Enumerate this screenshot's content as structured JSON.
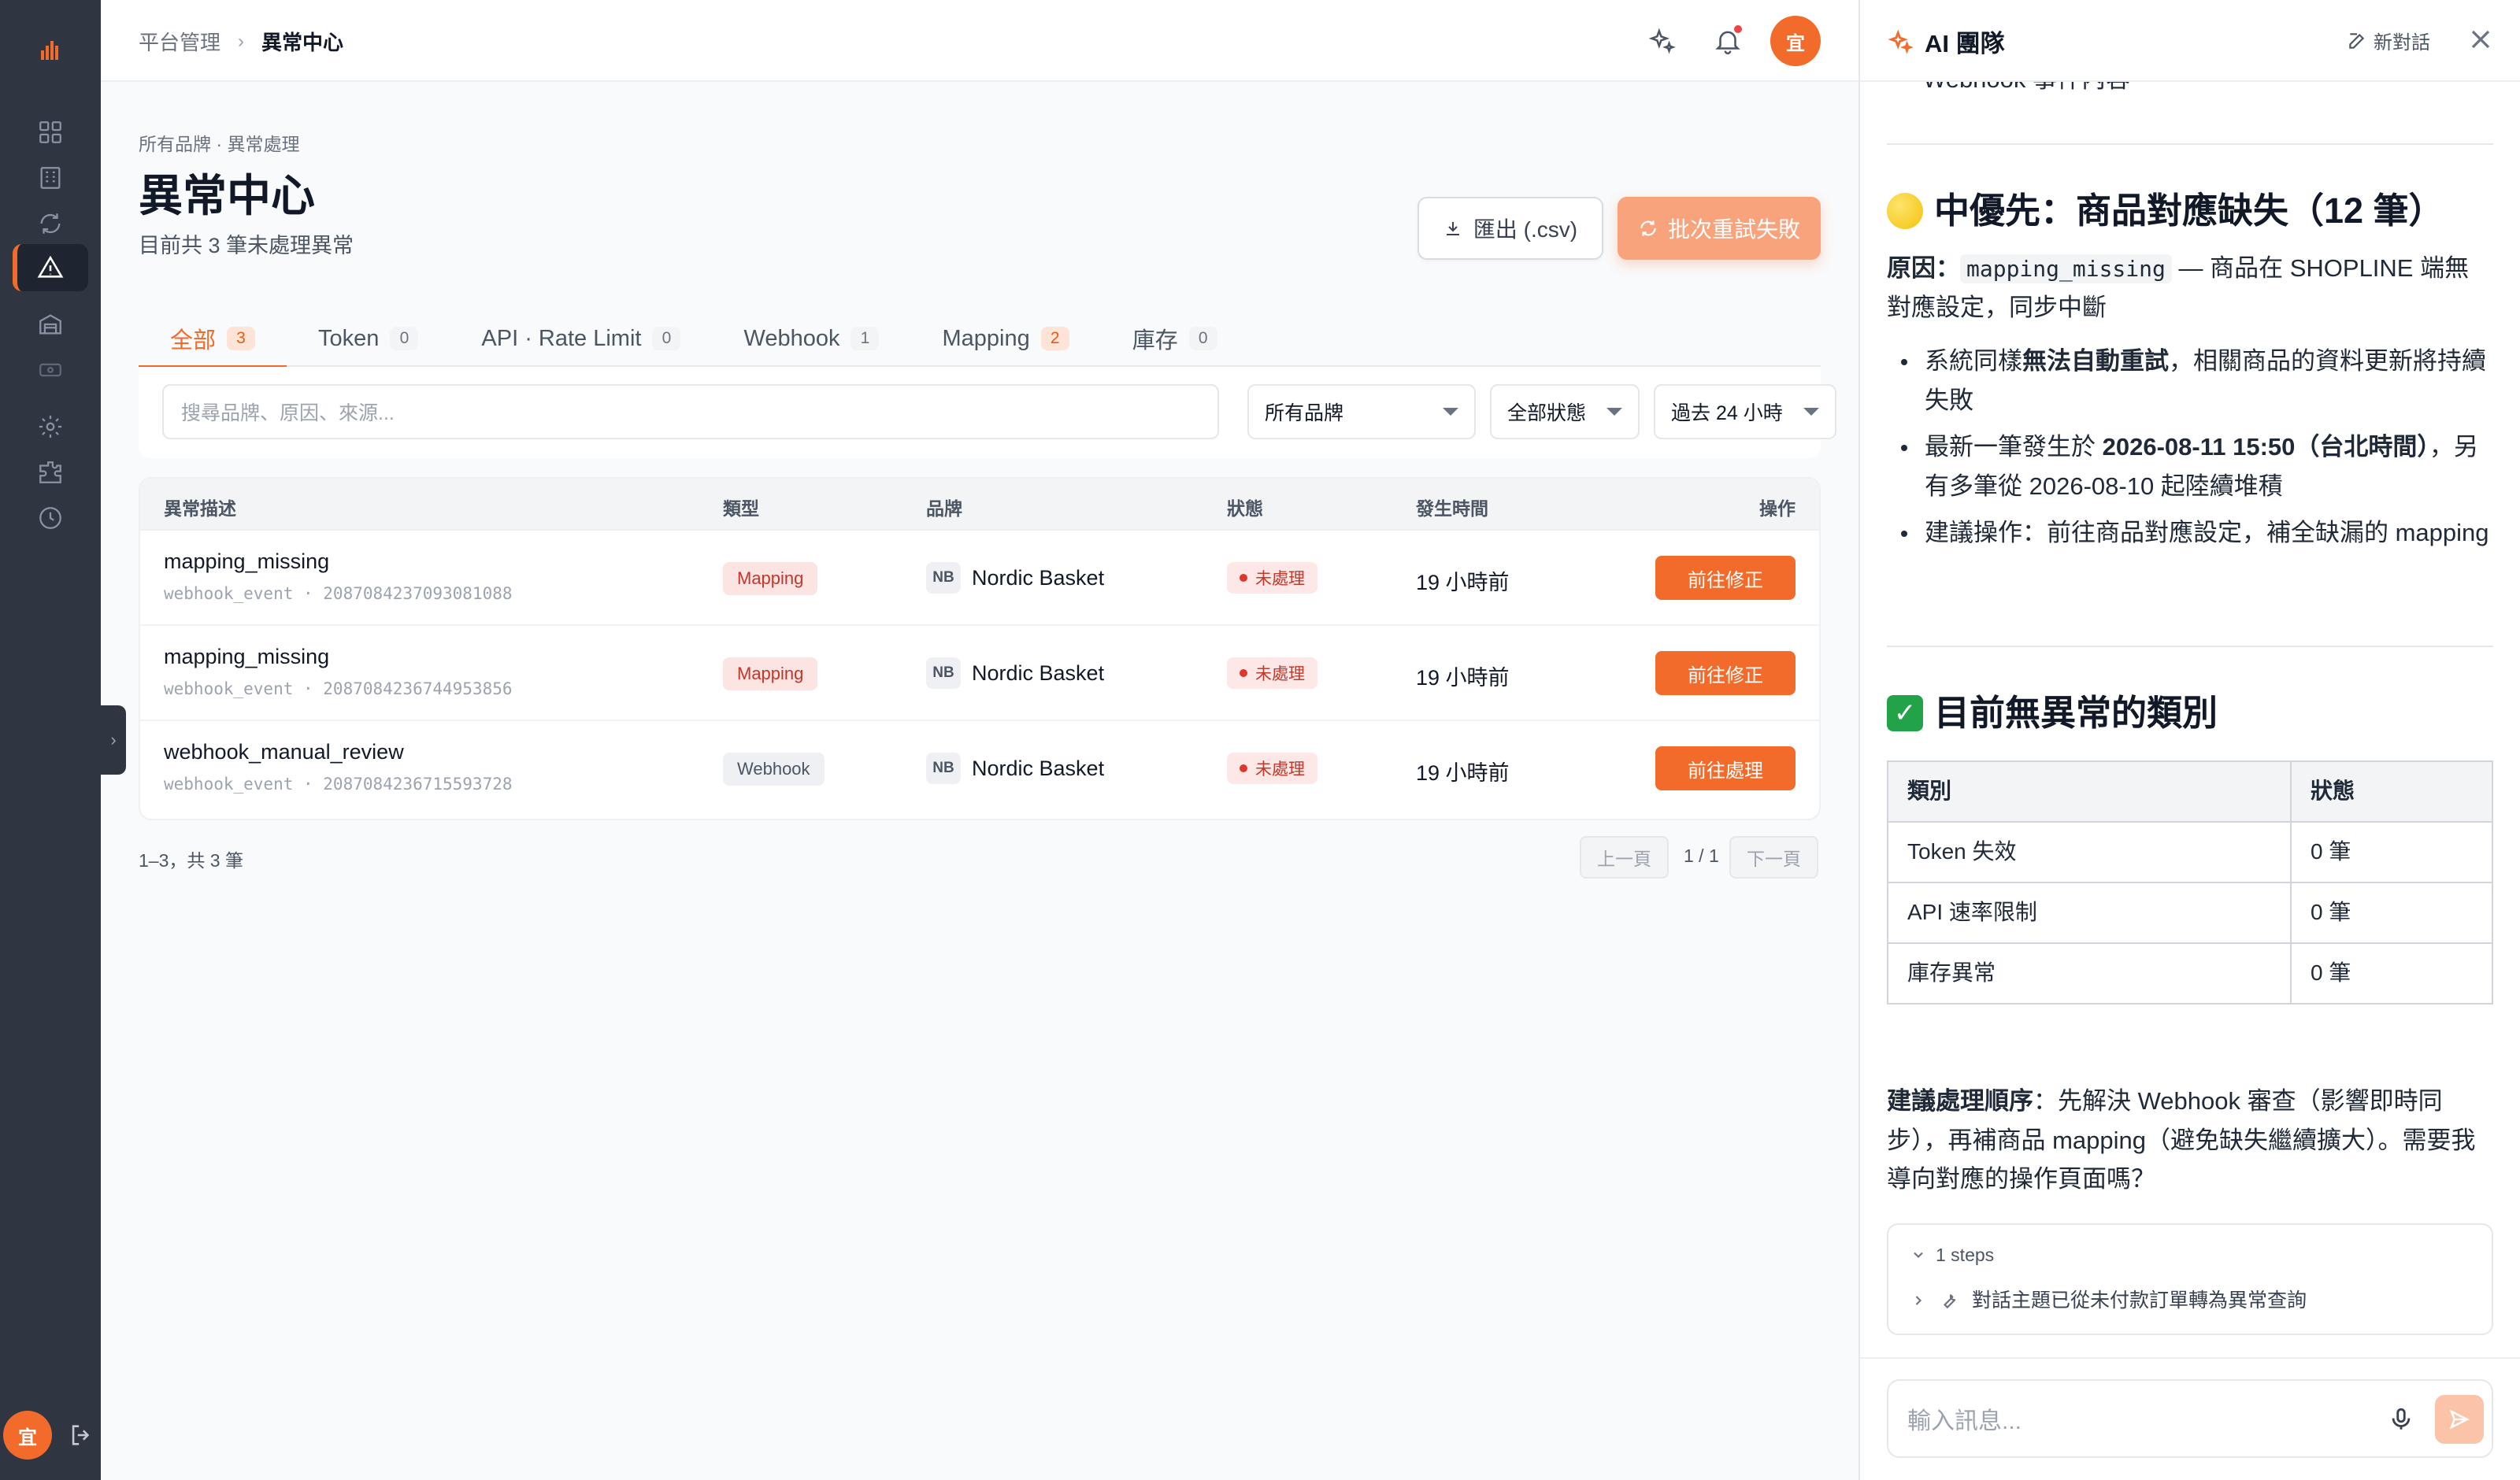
{
  "topbar": {
    "breadcrumb_root": "平台管理",
    "breadcrumb_current": "異常中心",
    "avatar_text": "宜"
  },
  "header": {
    "sub_breadcrumb": "所有品牌 · 異常處理",
    "title": "異常中心",
    "subtitle": "目前共 3 筆未處理異常",
    "export_label": "匯出 (.csv)",
    "retry_label": "批次重試失敗"
  },
  "tabs": [
    {
      "label": "全部",
      "count": "3"
    },
    {
      "label": "Token",
      "count": "0"
    },
    {
      "label": "API · Rate Limit",
      "count": "0"
    },
    {
      "label": "Webhook",
      "count": "1"
    },
    {
      "label": "Mapping",
      "count": "2"
    },
    {
      "label": "庫存",
      "count": "0"
    }
  ],
  "filters": {
    "search_placeholder": "搜尋品牌、原因、來源...",
    "brand": "所有品牌",
    "status": "全部狀態",
    "range": "過去 24 小時"
  },
  "table": {
    "columns": [
      "異常描述",
      "類型",
      "品牌",
      "狀態",
      "發生時間",
      "操作"
    ],
    "rows": [
      {
        "title": "mapping_missing",
        "meta": "webhook_event · 2087084237093081088",
        "type": "Mapping",
        "brand_mark": "NB",
        "brand": "Nordic Basket",
        "status": "未處理",
        "time": "19 小時前",
        "action": "前往修正"
      },
      {
        "title": "mapping_missing",
        "meta": "webhook_event · 2087084236744953856",
        "type": "Mapping",
        "brand_mark": "NB",
        "brand": "Nordic Basket",
        "status": "未處理",
        "time": "19 小時前",
        "action": "前往修正"
      },
      {
        "title": "webhook_manual_review",
        "meta": "webhook_event · 2087084236715593728",
        "type": "Webhook",
        "brand_mark": "NB",
        "brand": "Nordic Basket",
        "status": "未處理",
        "time": "19 小時前",
        "action": "前往處理"
      }
    ]
  },
  "pager": {
    "info": "1–3，共 3 筆",
    "prev": "上一頁",
    "page": "1 / 1",
    "next": "下一頁"
  },
  "ai": {
    "title": "AI 團隊",
    "new_chat": "新對話",
    "clipped_text": "Webhook 事件內容",
    "section1_title": "中優先：商品對應缺失（12 筆）",
    "reason_label": "原因：",
    "reason_code": "mapping_missing",
    "reason_rest_1": " — 商品在 SHOPLINE 端無",
    "reason_rest_2": "對應設定，同步中斷",
    "bullet1_a": "系統同樣",
    "bullet1_b": "無法自動重試",
    "bullet1_c": "，相關商品的資料更新將持續失敗",
    "bullet2_a": "最新一筆發生於 ",
    "bullet2_b": "2026-08-11 15:50（台北時間）",
    "bullet2_c": "，另有多筆從 2026-08-10 起陸續堆積",
    "bullet3": "建議操作：前往商品對應設定，補全缺漏的 mapping",
    "section2_title": "目前無異常的類別",
    "table_headers": [
      "類別",
      "狀態"
    ],
    "table_rows": [
      {
        "category": "Token 失效",
        "status": "0 筆"
      },
      {
        "category": "API 速率限制",
        "status": "0 筆"
      },
      {
        "category": "庫存異常",
        "status": "0 筆"
      }
    ],
    "suggest_label": "建議處理順序",
    "suggest_text": "：先解決 Webhook 審查（影響即時同步），再補商品 mapping（避免缺失繼續擴大）。需要我導向對應的操作頁面嗎？",
    "steps_label": "1 steps",
    "steps_item": "對話主題已從未付款訂單轉為異常查詢",
    "input_placeholder": "輸入訊息..."
  },
  "colors": {
    "accent": "#f26b2a",
    "rail": "#2f3642",
    "danger": "#c0392b"
  }
}
